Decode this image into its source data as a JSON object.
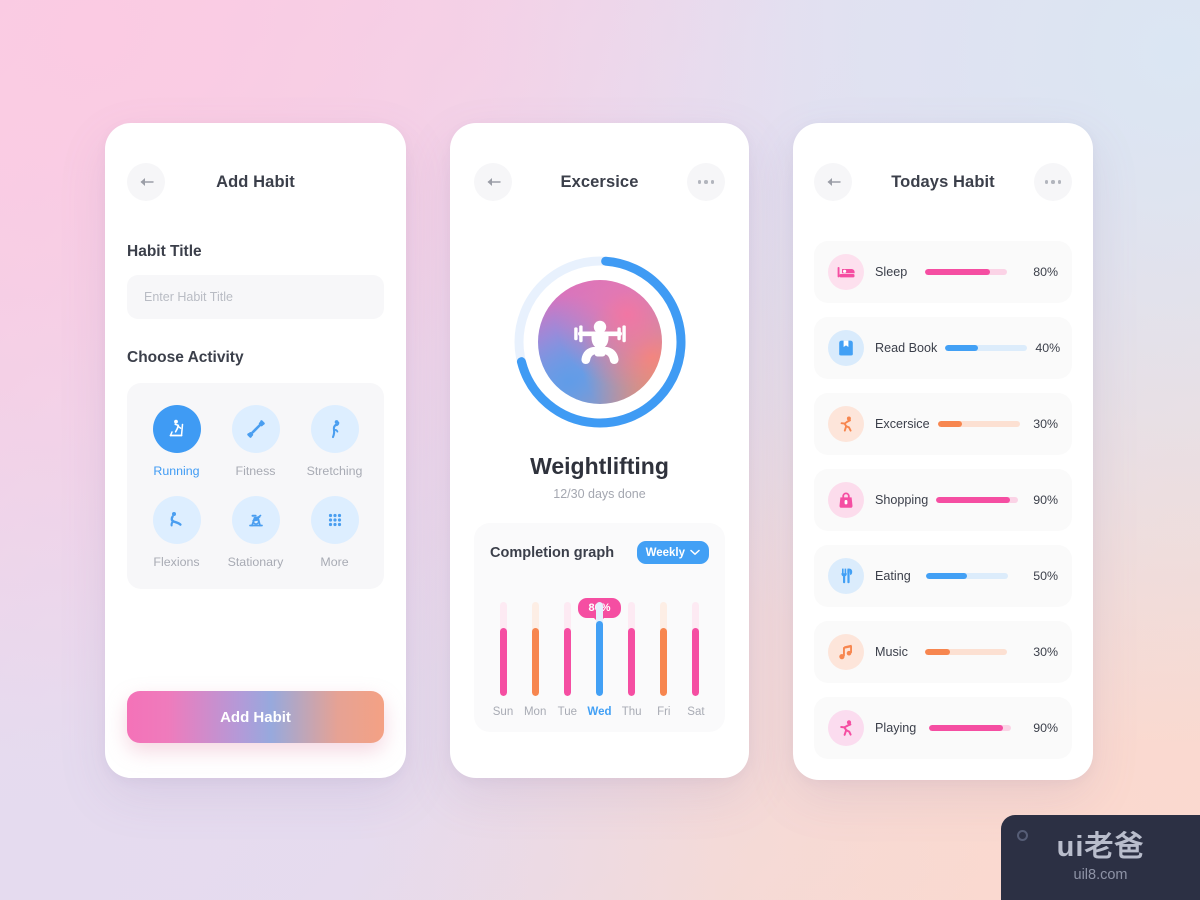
{
  "add_habit": {
    "header": {
      "title": "Add Habit",
      "back_icon": "arrow-left-icon"
    },
    "title_label": "Habit Title",
    "title_placeholder": "Enter Habit Title",
    "title_value": "",
    "activity_label": "Choose Activity",
    "activities": [
      {
        "label": "Running",
        "icon": "treadmill-icon",
        "selected": true
      },
      {
        "label": "Fitness",
        "icon": "dumbbell-icon",
        "selected": false
      },
      {
        "label": "Stretching",
        "icon": "stretching-icon",
        "selected": false
      },
      {
        "label": "Flexions",
        "icon": "flexion-icon",
        "selected": false
      },
      {
        "label": "Stationary",
        "icon": "exercise-bike-icon",
        "selected": false
      },
      {
        "label": "More",
        "icon": "grid-dots-icon",
        "selected": false
      }
    ],
    "cta_label": "Add Habit"
  },
  "exercise": {
    "header": {
      "title": "Excersice",
      "back_icon": "arrow-left-icon",
      "more_icon": "more-horizontal-icon"
    },
    "ring": {
      "percent": 70,
      "track_color": "#e8f1fd",
      "progress_color": "#3f9bf4"
    },
    "core_icon": "weightlifter-icon",
    "habit_name": "Weightlifting",
    "progress_text": "12/30 days done",
    "graph": {
      "title": "Completion graph",
      "range_label": "Weekly",
      "range_icon": "chevron-down-icon",
      "tooltip": "80%"
    },
    "chart_data": {
      "type": "bar",
      "title": "Completion graph",
      "categories": [
        "Sun",
        "Mon",
        "Tue",
        "Wed",
        "Thu",
        "Fri",
        "Sat"
      ],
      "values": [
        72,
        72,
        72,
        80,
        72,
        72,
        72
      ],
      "highlight_index": 3,
      "highlight_value": 80,
      "xlabel": "",
      "ylabel": "",
      "ylim": [
        0,
        100
      ],
      "grid": false,
      "legend": "none",
      "bar_colors": [
        "#f54ea2",
        "#f7864f",
        "#f54ea2",
        "#42a0f5",
        "#f54ea2",
        "#f7864f",
        "#f54ea2"
      ],
      "track_colors": [
        "#fdeaf3",
        "#fdeee5",
        "#fdeaf3",
        "#e4f0fd",
        "#fdeaf3",
        "#fdeee5",
        "#fdeaf3"
      ]
    }
  },
  "today": {
    "header": {
      "title": "Todays Habit",
      "back_icon": "arrow-left-icon",
      "more_icon": "more-horizontal-icon"
    },
    "habits": [
      {
        "label": "Sleep",
        "percent_label": "80%",
        "percent": 80,
        "icon": "bed-icon",
        "color": "#f54ea2",
        "track": "#fbd3e6",
        "chip": "#fde0ee"
      },
      {
        "label": "Read Book",
        "percent_label": "40%",
        "percent": 40,
        "icon": "book-icon",
        "color": "#42a0f5",
        "track": "#dcecfb",
        "chip": "#d9ebfc"
      },
      {
        "label": "Excersice",
        "percent_label": "30%",
        "percent": 30,
        "icon": "runner-icon",
        "color": "#f7864f",
        "track": "#fce0d2",
        "chip": "#fde5da"
      },
      {
        "label": "Shopping",
        "percent_label": "90%",
        "percent": 90,
        "icon": "bag-icon",
        "color": "#f54ea2",
        "track": "#fbd3e6",
        "chip": "#fcdcec"
      },
      {
        "label": "Eating",
        "percent_label": "50%",
        "percent": 50,
        "icon": "cutlery-icon",
        "color": "#42a0f5",
        "track": "#dcecfb",
        "chip": "#dbecfc"
      },
      {
        "label": "Music",
        "percent_label": "30%",
        "percent": 30,
        "icon": "music-note-icon",
        "color": "#f7864f",
        "track": "#fce0d2",
        "chip": "#fde5da"
      },
      {
        "label": "Playing",
        "percent_label": "90%",
        "percent": 90,
        "icon": "running-icon",
        "color": "#f54ea2",
        "track": "#fbd3e6",
        "chip": "#fbdcef"
      }
    ]
  },
  "watermark": {
    "main": "ui老爸",
    "sub": "uil8.com",
    "dot_icon": "circle-icon"
  },
  "palette": {
    "pink": "#f54ea2",
    "orange": "#f7864f",
    "blue": "#42a0f5",
    "text_dark": "#3b3f4a",
    "text_muted": "#a8abb4"
  }
}
